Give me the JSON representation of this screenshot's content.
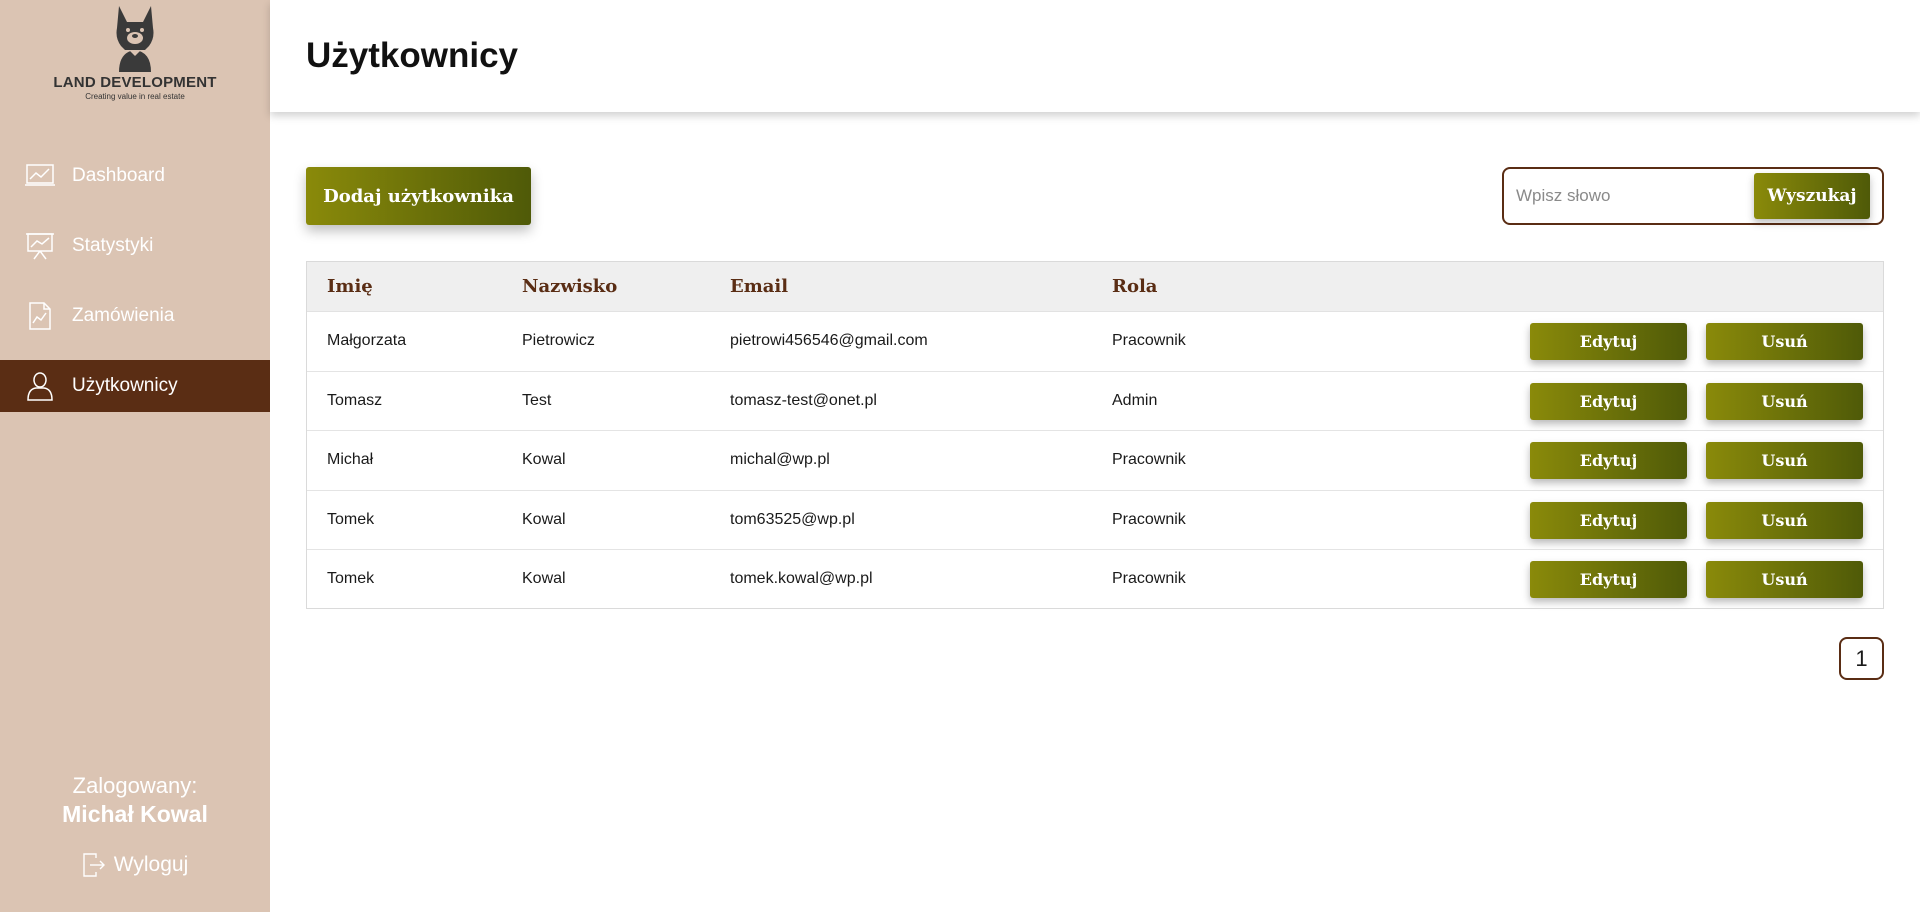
{
  "brand": {
    "name": "LAND DEVELOPMENT",
    "tagline": "Creating value in real estate"
  },
  "sidebar": {
    "items": [
      {
        "label": "Dashboard",
        "icon": "chart-line-icon"
      },
      {
        "label": "Statystyki",
        "icon": "presentation-chart-icon"
      },
      {
        "label": "Zamówienia",
        "icon": "document-chart-icon"
      },
      {
        "label": "Użytkownicy",
        "icon": "user-icon",
        "active": true
      }
    ],
    "login_label": "Zalogowany:",
    "login_name": "Michał Kowal",
    "logout_label": "Wyloguj"
  },
  "header": {
    "title": "Użytkownicy"
  },
  "toolbar": {
    "add_label": "Dodaj użytkownika",
    "search_placeholder": "Wpisz słowo",
    "search_label": "Wyszukaj"
  },
  "table": {
    "columns": [
      "Imię",
      "Nazwisko",
      "Email",
      "Rola"
    ],
    "rows": [
      {
        "first": "Małgorzata",
        "last": "Pietrowicz",
        "email": "pietrowi456546@gmail.com",
        "role": "Pracownik"
      },
      {
        "first": "Tomasz",
        "last": "Test",
        "email": "tomasz-test@onet.pl",
        "role": "Admin"
      },
      {
        "first": "Michał",
        "last": "Kowal",
        "email": "michal@wp.pl",
        "role": "Pracownik"
      },
      {
        "first": "Tomek",
        "last": "Kowal",
        "email": "tom63525@wp.pl",
        "role": "Pracownik"
      },
      {
        "first": "Tomek",
        "last": "Kowal",
        "email": "tomek.kowal@wp.pl",
        "role": "Pracownik"
      }
    ],
    "edit_label": "Edytuj",
    "delete_label": "Usuń"
  },
  "pagination": {
    "current_page": "1"
  },
  "colors": {
    "sidebar_bg": "#dbc4b3",
    "active_nav": "#5a2d14",
    "accent_gradient_start": "#8a8a0a",
    "accent_gradient_end": "#4f5a08",
    "header_text": "#5a2d14"
  }
}
